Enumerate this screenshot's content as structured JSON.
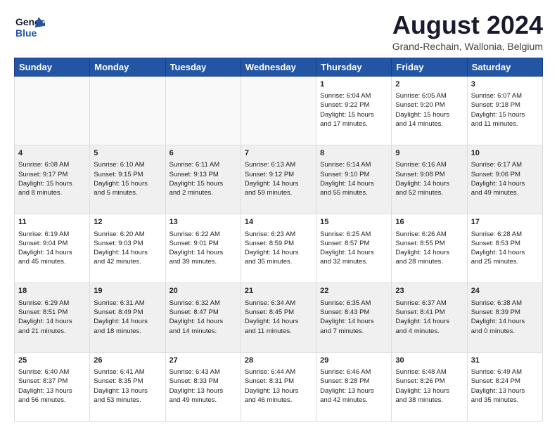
{
  "header": {
    "logo_general": "General",
    "logo_blue": "Blue",
    "title": "August 2024",
    "subtitle": "Grand-Rechain, Wallonia, Belgium"
  },
  "days_of_week": [
    "Sunday",
    "Monday",
    "Tuesday",
    "Wednesday",
    "Thursday",
    "Friday",
    "Saturday"
  ],
  "weeks": [
    {
      "shade": "white",
      "days": [
        {
          "num": "",
          "info": ""
        },
        {
          "num": "",
          "info": ""
        },
        {
          "num": "",
          "info": ""
        },
        {
          "num": "",
          "info": ""
        },
        {
          "num": "1",
          "info": "Sunrise: 6:04 AM\nSunset: 9:22 PM\nDaylight: 15 hours\nand 17 minutes."
        },
        {
          "num": "2",
          "info": "Sunrise: 6:05 AM\nSunset: 9:20 PM\nDaylight: 15 hours\nand 14 minutes."
        },
        {
          "num": "3",
          "info": "Sunrise: 6:07 AM\nSunset: 9:18 PM\nDaylight: 15 hours\nand 11 minutes."
        }
      ]
    },
    {
      "shade": "shaded",
      "days": [
        {
          "num": "4",
          "info": "Sunrise: 6:08 AM\nSunset: 9:17 PM\nDaylight: 15 hours\nand 8 minutes."
        },
        {
          "num": "5",
          "info": "Sunrise: 6:10 AM\nSunset: 9:15 PM\nDaylight: 15 hours\nand 5 minutes."
        },
        {
          "num": "6",
          "info": "Sunrise: 6:11 AM\nSunset: 9:13 PM\nDaylight: 15 hours\nand 2 minutes."
        },
        {
          "num": "7",
          "info": "Sunrise: 6:13 AM\nSunset: 9:12 PM\nDaylight: 14 hours\nand 59 minutes."
        },
        {
          "num": "8",
          "info": "Sunrise: 6:14 AM\nSunset: 9:10 PM\nDaylight: 14 hours\nand 55 minutes."
        },
        {
          "num": "9",
          "info": "Sunrise: 6:16 AM\nSunset: 9:08 PM\nDaylight: 14 hours\nand 52 minutes."
        },
        {
          "num": "10",
          "info": "Sunrise: 6:17 AM\nSunset: 9:06 PM\nDaylight: 14 hours\nand 49 minutes."
        }
      ]
    },
    {
      "shade": "white",
      "days": [
        {
          "num": "11",
          "info": "Sunrise: 6:19 AM\nSunset: 9:04 PM\nDaylight: 14 hours\nand 45 minutes."
        },
        {
          "num": "12",
          "info": "Sunrise: 6:20 AM\nSunset: 9:03 PM\nDaylight: 14 hours\nand 42 minutes."
        },
        {
          "num": "13",
          "info": "Sunrise: 6:22 AM\nSunset: 9:01 PM\nDaylight: 14 hours\nand 39 minutes."
        },
        {
          "num": "14",
          "info": "Sunrise: 6:23 AM\nSunset: 8:59 PM\nDaylight: 14 hours\nand 35 minutes."
        },
        {
          "num": "15",
          "info": "Sunrise: 6:25 AM\nSunset: 8:57 PM\nDaylight: 14 hours\nand 32 minutes."
        },
        {
          "num": "16",
          "info": "Sunrise: 6:26 AM\nSunset: 8:55 PM\nDaylight: 14 hours\nand 28 minutes."
        },
        {
          "num": "17",
          "info": "Sunrise: 6:28 AM\nSunset: 8:53 PM\nDaylight: 14 hours\nand 25 minutes."
        }
      ]
    },
    {
      "shade": "shaded",
      "days": [
        {
          "num": "18",
          "info": "Sunrise: 6:29 AM\nSunset: 8:51 PM\nDaylight: 14 hours\nand 21 minutes."
        },
        {
          "num": "19",
          "info": "Sunrise: 6:31 AM\nSunset: 8:49 PM\nDaylight: 14 hours\nand 18 minutes."
        },
        {
          "num": "20",
          "info": "Sunrise: 6:32 AM\nSunset: 8:47 PM\nDaylight: 14 hours\nand 14 minutes."
        },
        {
          "num": "21",
          "info": "Sunrise: 6:34 AM\nSunset: 8:45 PM\nDaylight: 14 hours\nand 11 minutes."
        },
        {
          "num": "22",
          "info": "Sunrise: 6:35 AM\nSunset: 8:43 PM\nDaylight: 14 hours\nand 7 minutes."
        },
        {
          "num": "23",
          "info": "Sunrise: 6:37 AM\nSunset: 8:41 PM\nDaylight: 14 hours\nand 4 minutes."
        },
        {
          "num": "24",
          "info": "Sunrise: 6:38 AM\nSunset: 8:39 PM\nDaylight: 14 hours\nand 0 minutes."
        }
      ]
    },
    {
      "shade": "white",
      "days": [
        {
          "num": "25",
          "info": "Sunrise: 6:40 AM\nSunset: 8:37 PM\nDaylight: 13 hours\nand 56 minutes."
        },
        {
          "num": "26",
          "info": "Sunrise: 6:41 AM\nSunset: 8:35 PM\nDaylight: 13 hours\nand 53 minutes."
        },
        {
          "num": "27",
          "info": "Sunrise: 6:43 AM\nSunset: 8:33 PM\nDaylight: 13 hours\nand 49 minutes."
        },
        {
          "num": "28",
          "info": "Sunrise: 6:44 AM\nSunset: 8:31 PM\nDaylight: 13 hours\nand 46 minutes."
        },
        {
          "num": "29",
          "info": "Sunrise: 6:46 AM\nSunset: 8:28 PM\nDaylight: 13 hours\nand 42 minutes."
        },
        {
          "num": "30",
          "info": "Sunrise: 6:48 AM\nSunset: 8:26 PM\nDaylight: 13 hours\nand 38 minutes."
        },
        {
          "num": "31",
          "info": "Sunrise: 6:49 AM\nSunset: 8:24 PM\nDaylight: 13 hours\nand 35 minutes."
        }
      ]
    }
  ]
}
